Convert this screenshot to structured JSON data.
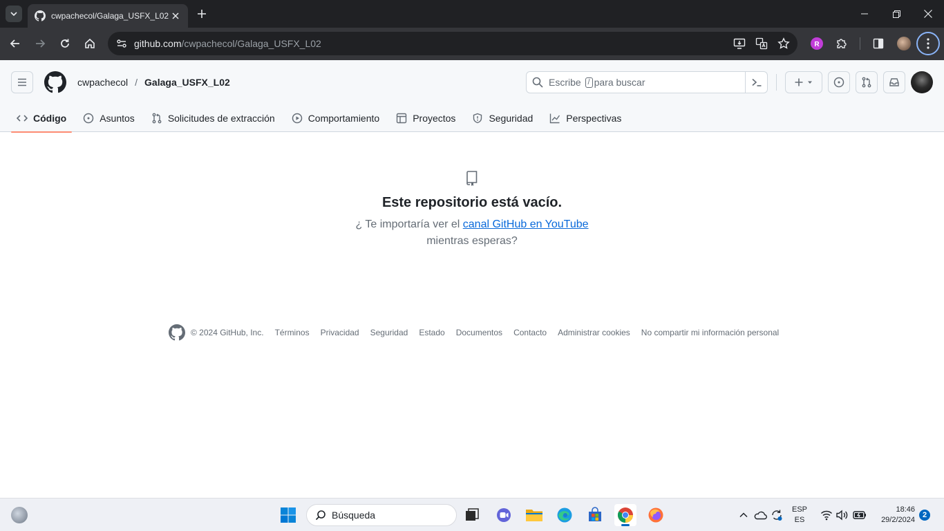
{
  "browser": {
    "tab_title": "cwpachecol/Galaga_USFX_L02",
    "url_host": "github.com",
    "url_path": "/cwpachecol/Galaga_USFX_L02"
  },
  "header": {
    "owner": "cwpachecol",
    "separator": "/",
    "repo": "Galaga_USFX_L02",
    "search_before": "Escribe",
    "search_key": "/",
    "search_after": "para buscar"
  },
  "repo_nav": [
    {
      "label": "Código",
      "icon": "code-icon",
      "active": true
    },
    {
      "label": "Asuntos",
      "icon": "issue-icon",
      "active": false
    },
    {
      "label": "Solicitudes de extracción",
      "icon": "pull-request-icon",
      "active": false
    },
    {
      "label": "Comportamiento",
      "icon": "play-icon",
      "active": false
    },
    {
      "label": "Proyectos",
      "icon": "table-icon",
      "active": false
    },
    {
      "label": "Seguridad",
      "icon": "shield-icon",
      "active": false
    },
    {
      "label": "Perspectivas",
      "icon": "graph-icon",
      "active": false
    }
  ],
  "empty_state": {
    "title": "Este repositorio está vacío.",
    "text_before": "¿ Te importaría ver el",
    "link": "canal GitHub en YouTube",
    "text_after": "mientras esperas?"
  },
  "footer": {
    "copyright": "© 2024 GitHub, Inc.",
    "links": [
      "Términos",
      "Privacidad",
      "Seguridad",
      "Estado",
      "Documentos",
      "Contacto",
      "Administrar cookies",
      "No compartir mi información personal"
    ]
  },
  "taskbar": {
    "search_label": "Búsqueda",
    "lang_top": "ESP",
    "lang_bottom": "ES",
    "time": "18:46",
    "date": "29/2/2024",
    "notifications": "2"
  },
  "colors": {
    "accent_link": "#0969da",
    "active_tab_underline": "#fd8c73",
    "chrome_dark": "#202124"
  }
}
